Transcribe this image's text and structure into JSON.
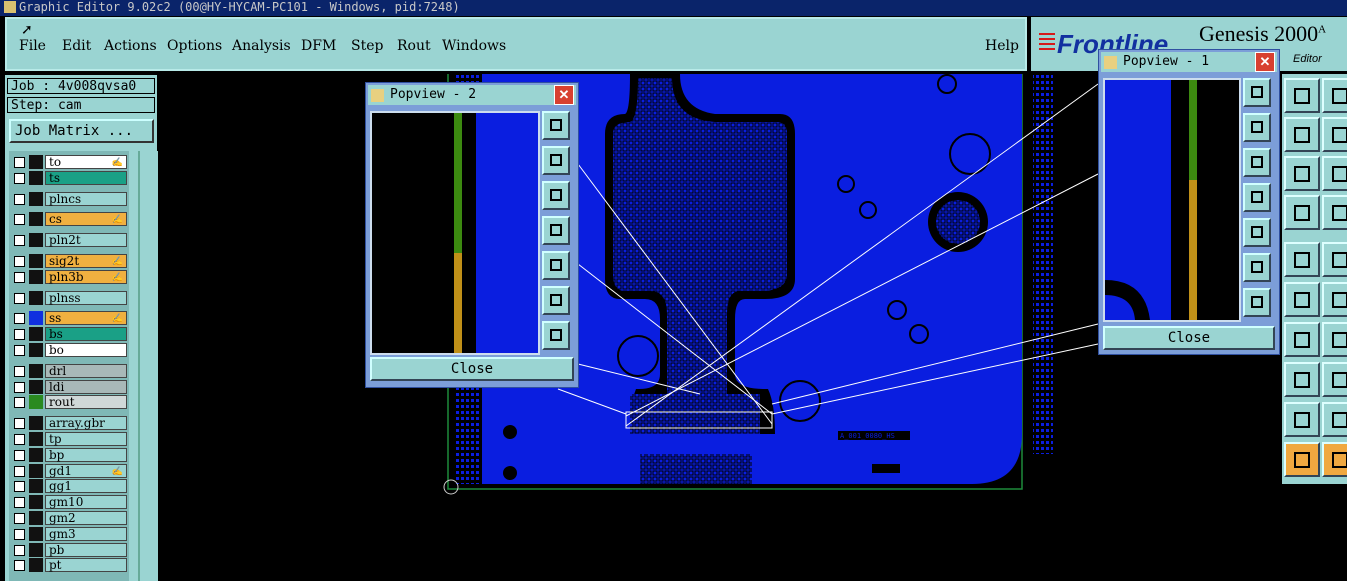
{
  "titlebar": {
    "title": "Graphic Editor 9.02c2 (00@HY-HYCAM-PC101 - Windows, pid:7248)"
  },
  "menu": {
    "items": [
      "File",
      "Edit",
      "Actions",
      "Options",
      "Analysis",
      "DFM",
      "Step",
      "Rout",
      "Windows"
    ],
    "help": "Help"
  },
  "brand": {
    "logo_text": "Frontline",
    "product": "Genesis 2000",
    "suffix": "A",
    "subtitle": "Editor"
  },
  "left": {
    "job": "Job : 4v008qvsa0",
    "step": "Step: cam",
    "job_matrix": "Job Matrix ...",
    "layers": [
      {
        "name": "to",
        "color": "#ffffff",
        "hand": true
      },
      {
        "name": "ts",
        "color": "#1aa086",
        "hand": false
      },
      {
        "name": "plncs",
        "color": "#9ad4d2",
        "hand": false
      },
      {
        "name": "cs",
        "color": "#f0b040",
        "hand": true
      },
      {
        "name": "pln2t",
        "color": "#9ad4d2",
        "hand": false
      },
      {
        "name": "sig2t",
        "color": "#f0b040",
        "hand": true
      },
      {
        "name": "pln3b",
        "color": "#f0b040",
        "hand": true
      },
      {
        "name": "plnss",
        "color": "#9ad4d2",
        "hand": false
      },
      {
        "name": "ss",
        "color": "#f0b040",
        "hand": true
      },
      {
        "name": "bs",
        "color": "#1aa086",
        "hand": false
      },
      {
        "name": "bo",
        "color": "#ffffff",
        "hand": false
      },
      {
        "name": "drl",
        "color": "#a8b8b8",
        "hand": false
      },
      {
        "name": "ldi",
        "color": "#a8b8b8",
        "hand": false
      },
      {
        "name": "rout",
        "color": "#d0d8d8",
        "hand": false
      },
      {
        "name": "array.gbr",
        "color": "#9ad4d2",
        "hand": false
      },
      {
        "name": "tp",
        "color": "#9ad4d2",
        "hand": false
      },
      {
        "name": "bp",
        "color": "#9ad4d2",
        "hand": false
      },
      {
        "name": "gd1",
        "color": "#9ad4d2",
        "hand": true
      },
      {
        "name": "gg1",
        "color": "#9ad4d2",
        "hand": false
      },
      {
        "name": "gm10",
        "color": "#9ad4d2",
        "hand": false
      },
      {
        "name": "gm2",
        "color": "#9ad4d2",
        "hand": false
      },
      {
        "name": "gm3",
        "color": "#9ad4d2",
        "hand": false
      },
      {
        "name": "pb",
        "color": "#9ad4d2",
        "hand": false
      },
      {
        "name": "pt",
        "color": "#9ad4d2",
        "hand": false
      }
    ]
  },
  "board": {
    "label": "A_001_0080_HS"
  },
  "popview2": {
    "title": "Popview - 2",
    "close": "Close"
  },
  "popview1": {
    "title": "Popview - 1",
    "close": "Close"
  },
  "colors": {
    "board": "#0a1ee0",
    "outline": "#1e8a3a",
    "ui": "#9ad4d2"
  }
}
